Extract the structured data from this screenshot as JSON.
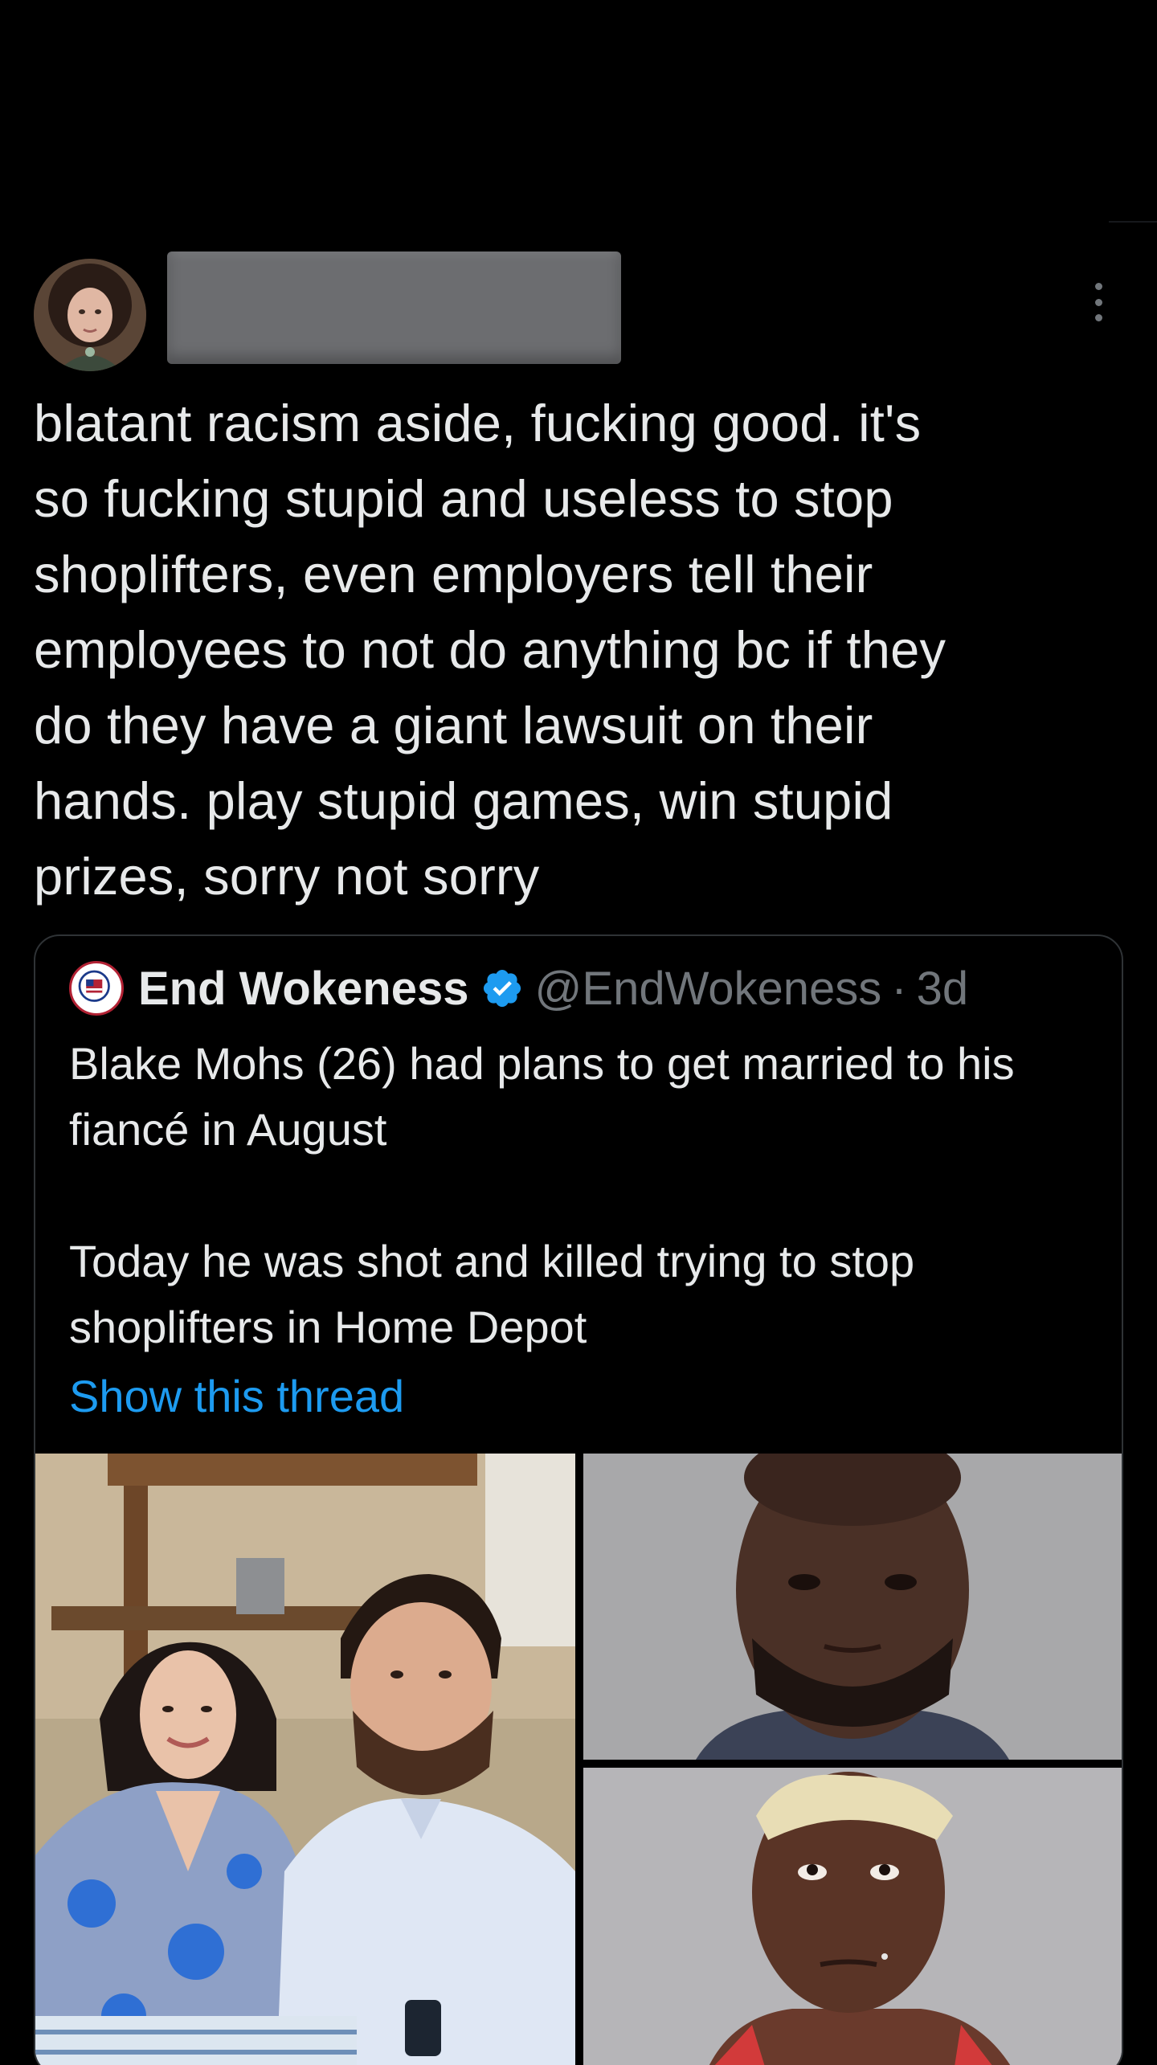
{
  "tweet": {
    "text": "blatant racism aside, fucking good. it's\nso fucking stupid and useless to stop\nshoplifters, even employers tell their\nemployees to not do anything bc if they\ndo they have a giant lawsuit on their\nhands. play stupid games, win stupid\nprizes, sorry not sorry"
  },
  "quote": {
    "name": "End Wokeness",
    "handle": "@EndWokeness",
    "separator": "·",
    "time": "3d",
    "line1": "Blake Mohs (26) had plans to get married to his fiancé in August",
    "line2": "Today he was shot and killed trying to stop shoplifters in Home Depot",
    "show_thread": "Show this thread"
  },
  "colors": {
    "background": "#000000",
    "text": "#e7e9ea",
    "secondary": "#71767b",
    "link": "#1d9bf0",
    "border": "#2f3336",
    "verified": "#1d9bf0"
  },
  "icons": [
    "more-icon",
    "verified-badge-icon"
  ]
}
